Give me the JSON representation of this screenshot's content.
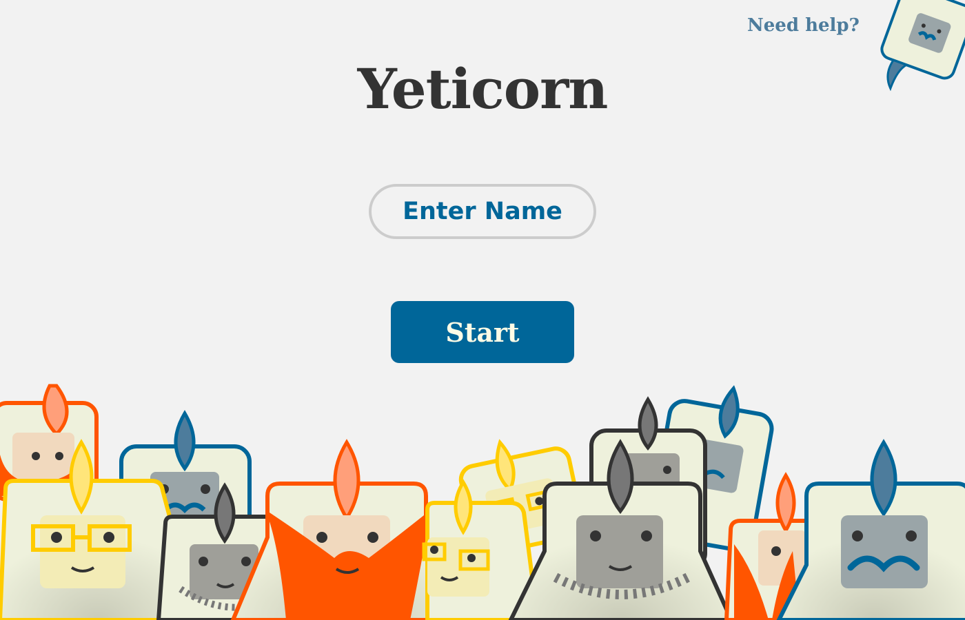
{
  "app": {
    "title": "Yeticorn"
  },
  "help": {
    "label": "Need help?",
    "avatar_icon": "yeti-helper-icon"
  },
  "name_input": {
    "placeholder": "Enter Name",
    "value": ""
  },
  "start_button": {
    "label": "Start"
  },
  "crowd": {
    "decoration": "yeticorn-crowd-illustration"
  },
  "colors": {
    "background": "#f2f2f2",
    "title": "#333333",
    "accent_blue": "#006699",
    "help_text": "#4d7c9c",
    "input_border": "#cccccc",
    "button_text": "#fdfbe6",
    "yeti_body": "#eef1dc",
    "yeti_orange": "#ff5500",
    "yeti_yellow": "#ffcc00",
    "yeti_gray": "#333333"
  }
}
